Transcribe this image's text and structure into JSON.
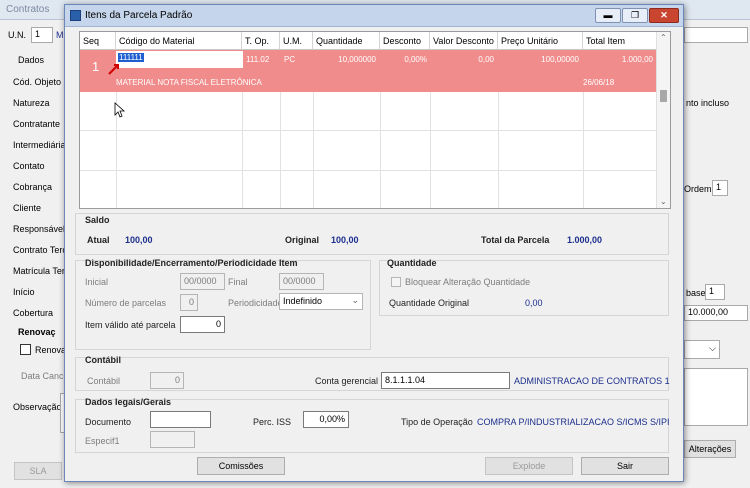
{
  "background": {
    "title": "Contratos",
    "un_label": "U.N.",
    "un_value": "1",
    "un_code": "M",
    "tab_dados": "Dados",
    "fields": [
      "Cód. Objeto",
      "Natureza",
      "Contratante",
      "Intermediária",
      "Contato",
      "Cobrança",
      "Cliente",
      "Responsável",
      "Contrato Terc",
      "Matrícula Terc",
      "Início",
      "Cobertura"
    ],
    "renovacao_label": "Renovaç",
    "renovacao_check": "Renova",
    "data_canc": "Data Cance",
    "observacao": "Observação",
    "right_text": "nto incluso",
    "ordem_label": "Ordem",
    "ordem_value": "1",
    "base_label": "base",
    "base_value": "1",
    "amount": "10.000,00",
    "alteracoes_btn": "Alterações",
    "sla_btn": "SLA"
  },
  "dialog": {
    "title": "Itens da Parcela Padrão",
    "grid": {
      "columns": [
        "Seq",
        "Código do Material",
        "T. Op.",
        "U.M.",
        "Quantidade",
        "Desconto",
        "Valor Desconto",
        "Preço Unitário",
        "Total Item"
      ],
      "row": {
        "seq": "1",
        "code": "111111",
        "t_op": "111.02",
        "um": "PC",
        "quantidade": "10,000000",
        "desconto": "0,00%",
        "valor_desconto": "0,00",
        "preco_unitario": "100,00000",
        "total_item": "1.000,00",
        "description": "MATERIAL NOTA FISCAL ELETRÔNICA",
        "date": "26/06/18"
      }
    },
    "saldo": {
      "title": "Saldo",
      "atual_label": "Atual",
      "atual_value": "100,00",
      "original_label": "Original",
      "original_value": "100,00",
      "total_label": "Total da Parcela",
      "total_value": "1.000,00"
    },
    "disponibilidade": {
      "title": "Disponibilidade/Encerramento/Periodicidade Item",
      "inicial_label": "Inicial",
      "inicial_value": "00/0000",
      "final_label": "Final",
      "final_value": "00/0000",
      "num_parcelas_label": "Número de parcelas",
      "num_parcelas_value": "0",
      "periodicidade_label": "Periodicidade",
      "periodicidade_value": "Indefinido",
      "item_valido_label": "Item válido até parcela",
      "item_valido_value": "0"
    },
    "quantidade": {
      "title": "Quantidade",
      "bloquear_label": "Bloquear Alteração Quantidade",
      "original_label": "Quantidade Original",
      "original_value": "0,00"
    },
    "contabil": {
      "title": "Contábil",
      "contabil_label": "Contábil",
      "contabil_value": "0",
      "conta_label": "Conta gerencial",
      "conta_value": "8.1.1.1.04",
      "conta_desc": "ADMINISTRACAO DE CONTRATOS 1"
    },
    "dados_legais": {
      "title": "Dados legais/Gerais",
      "documento_label": "Documento",
      "documento_value": "",
      "perc_iss_label": "Perc. ISS",
      "perc_iss_value": "0,00%",
      "tipo_op_label": "Tipo de Operação",
      "tipo_op_value": "COMPRA P/INDUSTRIALIZACAO S/ICMS S/IPI",
      "especif_label": "Especif1",
      "especif_value": ""
    },
    "buttons": {
      "comissoes": "Comissões",
      "explode": "Explode",
      "sair": "Sair"
    }
  },
  "colors": {
    "selected_row": "#f08c8c",
    "title_bar": "#c5d6ec",
    "value_blue": "#1b2e8c"
  }
}
